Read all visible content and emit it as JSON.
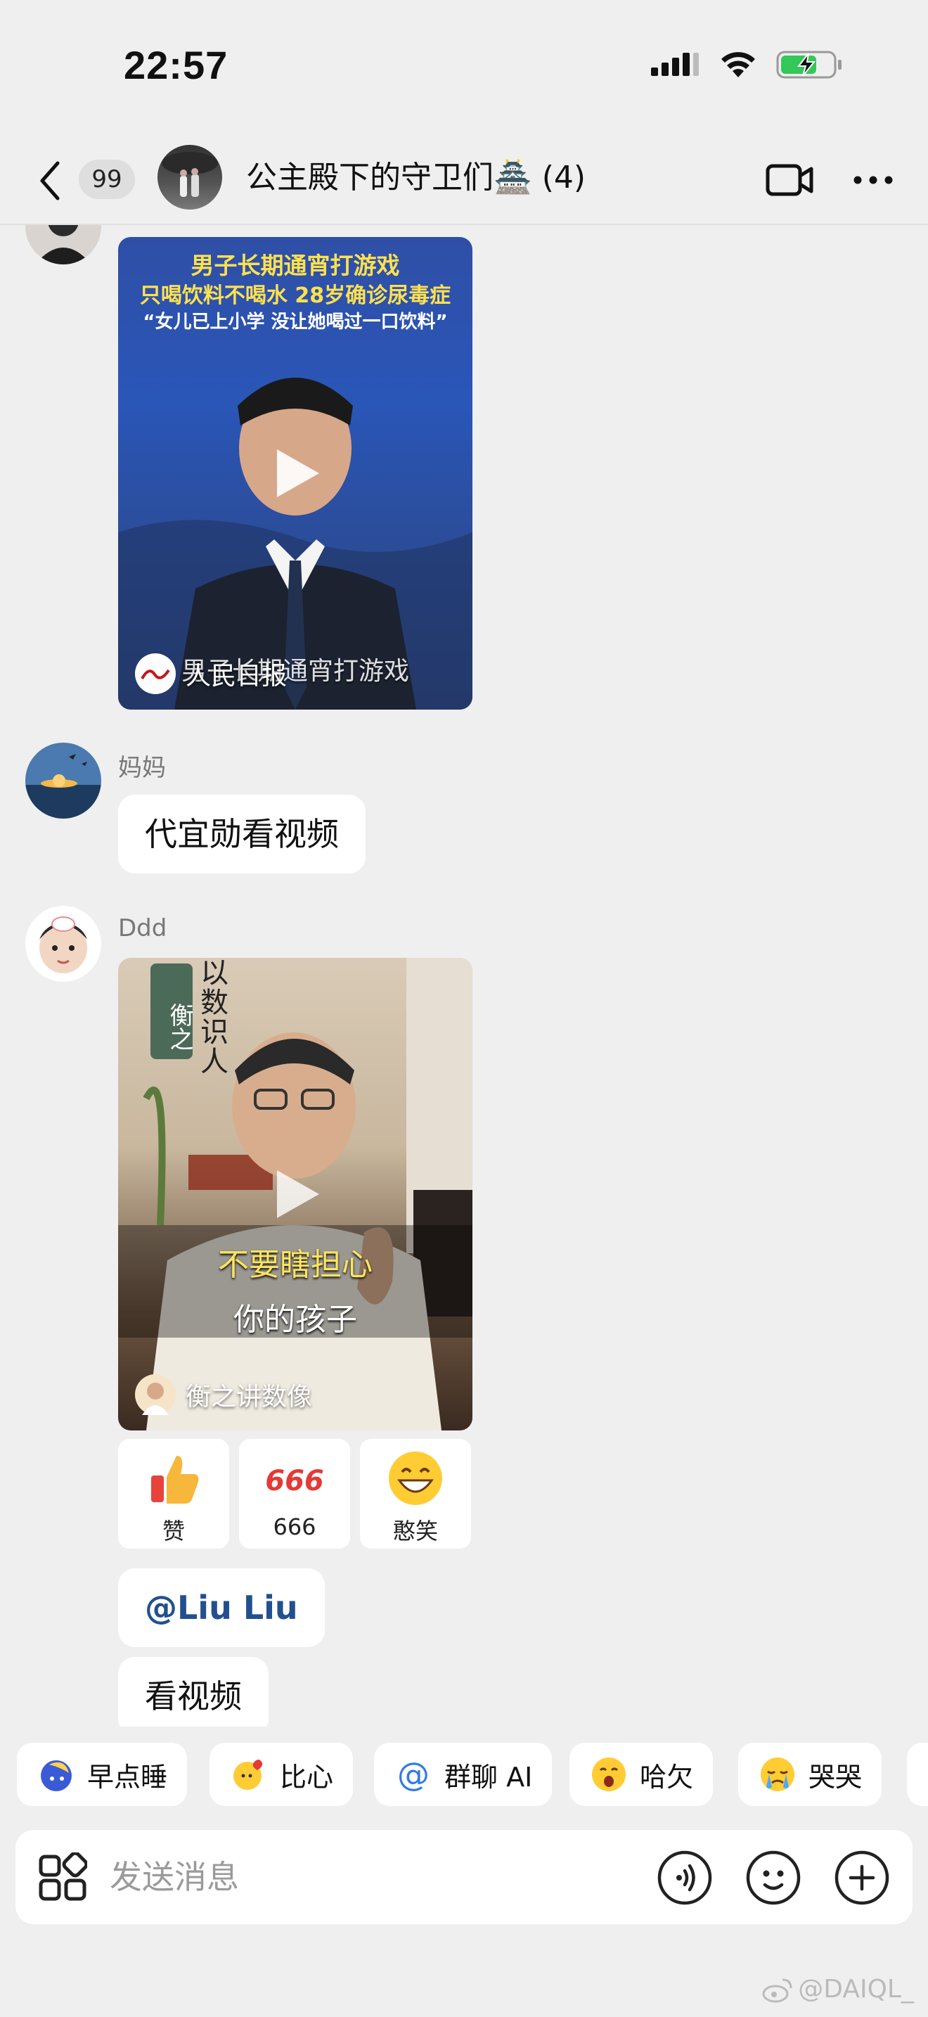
{
  "status_bar": {
    "time": "22:57"
  },
  "header": {
    "back_label": "<",
    "unread_count": "99",
    "group_title": "公主殿下的守卫们🏯 (4)"
  },
  "messages": {
    "video1": {
      "headline1": "男子长期通宵打游戏",
      "headline2": "只喝饮料不喝水 28岁确诊尿毒症",
      "headline3": "“女儿已上小学 没让她喝过一口饮料”",
      "caption": "男子长期通宵打游戏",
      "source_name": "人民日报"
    },
    "mom": {
      "name": "妈妈",
      "text": "代宜勋看视频"
    },
    "ddd": {
      "name": "Ddd",
      "video": {
        "vertical_text": "以数识人",
        "brand": "衡之",
        "subtitle1": "不要瞎担心",
        "subtitle2": "你的孩子",
        "source_name": "衡之讲数像"
      },
      "reactions": [
        {
          "label": "赞"
        },
        {
          "label": "666"
        },
        {
          "label": "憨笑"
        }
      ],
      "mention": "@Liu Liu",
      "text": "看视频"
    }
  },
  "quick_replies": [
    {
      "label": "早点睡"
    },
    {
      "label": "比心"
    },
    {
      "label": "群聊 AI"
    },
    {
      "label": "哈欠"
    },
    {
      "label": "哭哭"
    }
  ],
  "input": {
    "placeholder": "发送消息"
  },
  "watermark": "@DAIQL_",
  "colors": {
    "background": "#efefef",
    "mention": "#22508f",
    "battery": "#34c759",
    "bubble": "#ffffff"
  }
}
